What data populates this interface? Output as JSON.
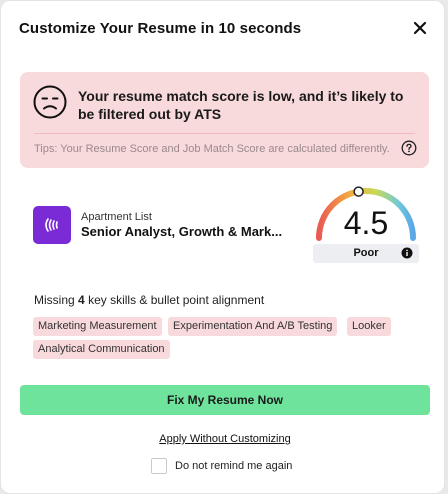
{
  "modal": {
    "title": "Customize Your Resume in 10 seconds",
    "close_icon": "close-icon"
  },
  "alert": {
    "icon": "sad-face-icon",
    "message": "Your resume match score is low, and it’s likely to be filtered out by ATS",
    "tip": "Tips: Your Resume Score and Job Match Score are calculated differently.",
    "help_icon": "question-circle-icon",
    "background": "#f8d9dc"
  },
  "job": {
    "company": "Apartment List",
    "role": "Senior Analyst, Growth & Mark...",
    "logo_icon": "apartment-list-logo",
    "logo_color": "#7a2bd6"
  },
  "score": {
    "value": "4.5",
    "label": "Poor",
    "gauge_fraction": 0.45,
    "info_icon": "info-icon"
  },
  "missing": {
    "prefix": "Missing",
    "count": "4",
    "suffix": "key skills & bullet point alignment"
  },
  "tags": [
    "Marketing Measurement",
    "Experimentation And A/B Testing",
    "Looker",
    "Analytical Communication"
  ],
  "actions": {
    "primary_label": "Fix My Resume Now",
    "primary_color": "#6ee39c",
    "secondary_label": "Apply Without Customizing",
    "remind_label": "Do not remind me again",
    "remind_checked": false
  }
}
